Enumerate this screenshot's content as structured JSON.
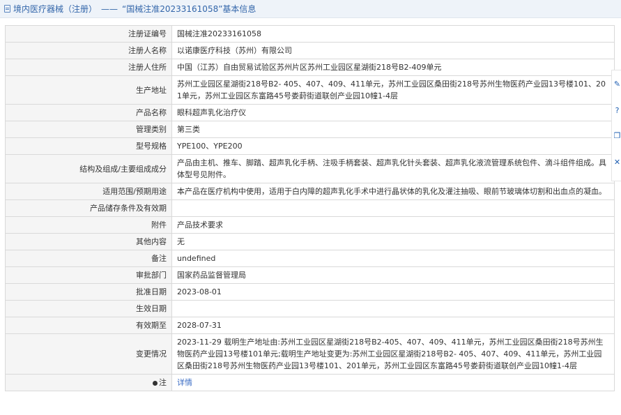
{
  "header": {
    "category": "境内医疗器械（注册）",
    "separator": "——",
    "title": "“国械注准20233161058”基本信息"
  },
  "rows": [
    {
      "label": "注册证编号",
      "value": "国械注准20233161058"
    },
    {
      "label": "注册人名称",
      "value": "以诺康医疗科技（苏州）有限公司"
    },
    {
      "label": "注册人住所",
      "value": "中国（江苏）自由贸易试验区苏州片区苏州工业园区星湖街218号B2-409单元"
    },
    {
      "label": "生产地址",
      "value": "苏州工业园区星湖街218号B2- 405、407、409、411单元，苏州工业园区桑田街218号苏州生物医药产业园13号楼101、201单元，苏州工业园区东富路45号娄葑街道联创产业园10幢1-4层"
    },
    {
      "label": "产品名称",
      "value": "眼科超声乳化治疗仪"
    },
    {
      "label": "管理类别",
      "value": "第三类"
    },
    {
      "label": "型号规格",
      "value": "YPE100、YPE200"
    },
    {
      "label": "结构及组成/主要组成成分",
      "value": "产品由主机、推车、脚踏、超声乳化手柄、注吸手柄套装、超声乳化针头套装、超声乳化液流管理系统包件、滴斗组件组成。具体型号见附件。"
    },
    {
      "label": "适用范围/预期用途",
      "value": "本产品在医疗机构中使用，适用于白内障的超声乳化手术中进行晶状体的乳化及灌注抽吸、眼前节玻璃体切割和出血点的凝血。"
    },
    {
      "label": "产品储存条件及有效期",
      "value": ""
    },
    {
      "label": "附件",
      "value": "产品技术要求"
    },
    {
      "label": "其他内容",
      "value": "无"
    },
    {
      "label": "备注",
      "value": "undefined"
    },
    {
      "label": "审批部门",
      "value": "国家药品监督管理局"
    },
    {
      "label": "批准日期",
      "value": "2023-08-01"
    },
    {
      "label": "生效日期",
      "value": ""
    },
    {
      "label": "有效期至",
      "value": "2028-07-31"
    },
    {
      "label": "变更情况",
      "value": "2023-11-29 载明生产地址由:苏州工业园区星湖街218号B2-405、407、409、411单元，苏州工业园区桑田街218号苏州生物医药产业园13号楼101单元;载明生产地址变更为:苏州工业园区星湖街218号B2- 405、407、409、411单元，苏州工业园区桑田街218号苏州生物医药产业园13号楼101、201单元，苏州工业园区东富路45号娄葑街道联创产业园10幢1-4层"
    }
  ],
  "note": {
    "label": "注",
    "link_text": "详情"
  },
  "side_tools": [
    "edit-icon",
    "help-icon",
    "copy-icon",
    "close-icon"
  ]
}
